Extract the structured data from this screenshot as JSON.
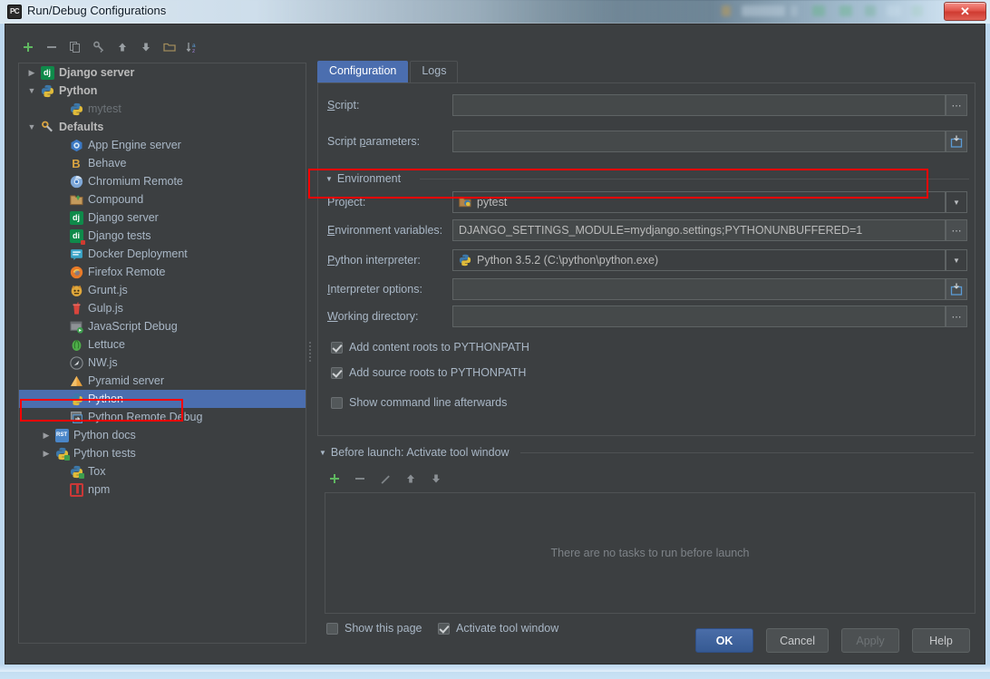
{
  "window": {
    "title": "Run/Debug Configurations",
    "app_icon": "PC",
    "close_label": "✕"
  },
  "tree_toolbar": [
    {
      "name": "add-configuration-button",
      "glyph": "+",
      "color": "#5fb760"
    },
    {
      "name": "remove-configuration-button",
      "glyph": "−",
      "color": "#8a8f93"
    },
    {
      "name": "copy-configuration-button",
      "glyph": "❐",
      "color": "#8a8f93"
    },
    {
      "name": "edit-templates-button",
      "glyph": "⚙",
      "color": "#8a8f93"
    },
    {
      "name": "move-up-button",
      "glyph": "↑",
      "color": "#9aa0a4"
    },
    {
      "name": "move-down-button",
      "glyph": "↓",
      "color": "#9aa0a4"
    },
    {
      "name": "create-folder-button",
      "glyph": "▱",
      "color": "#a08b5b"
    },
    {
      "name": "sort-alphabetically-button",
      "glyph": "↓az",
      "color": "#9aa0a4"
    }
  ],
  "tree": {
    "items": [
      {
        "label": "Django server",
        "icon": "django-icon",
        "indent": 1,
        "twisty": "collapsed",
        "style": "bold"
      },
      {
        "label": "Python",
        "icon": "python-icon",
        "indent": 1,
        "twisty": "expanded",
        "style": "bold"
      },
      {
        "label": "mytest",
        "icon": "python-icon",
        "indent": 3,
        "twisty": "none",
        "style": "dim"
      },
      {
        "label": "Defaults",
        "icon": "defaults-icon",
        "indent": 1,
        "twisty": "expanded",
        "style": "bold"
      },
      {
        "label": "App Engine server",
        "icon": "app-engine-icon",
        "indent": 3,
        "twisty": "none",
        "style": "normal"
      },
      {
        "label": "Behave",
        "icon": "behave-icon",
        "indent": 3,
        "twisty": "none",
        "style": "normal"
      },
      {
        "label": "Chromium Remote",
        "icon": "chromium-icon",
        "indent": 3,
        "twisty": "none",
        "style": "normal"
      },
      {
        "label": "Compound",
        "icon": "compound-icon",
        "indent": 3,
        "twisty": "none",
        "style": "normal"
      },
      {
        "label": "Django server",
        "icon": "django-icon",
        "indent": 3,
        "twisty": "none",
        "style": "normal"
      },
      {
        "label": "Django tests",
        "icon": "django-tests-icon",
        "indent": 3,
        "twisty": "none",
        "style": "normal"
      },
      {
        "label": "Docker Deployment",
        "icon": "docker-icon",
        "indent": 3,
        "twisty": "none",
        "style": "normal"
      },
      {
        "label": "Firefox Remote",
        "icon": "firefox-icon",
        "indent": 3,
        "twisty": "none",
        "style": "normal"
      },
      {
        "label": "Grunt.js",
        "icon": "grunt-icon",
        "indent": 3,
        "twisty": "none",
        "style": "normal"
      },
      {
        "label": "Gulp.js",
        "icon": "gulp-icon",
        "indent": 3,
        "twisty": "none",
        "style": "normal"
      },
      {
        "label": "JavaScript Debug",
        "icon": "javascript-debug-icon",
        "indent": 3,
        "twisty": "none",
        "style": "normal"
      },
      {
        "label": "Lettuce",
        "icon": "lettuce-icon",
        "indent": 3,
        "twisty": "none",
        "style": "normal"
      },
      {
        "label": "NW.js",
        "icon": "nwjs-icon",
        "indent": 3,
        "twisty": "none",
        "style": "normal"
      },
      {
        "label": "Pyramid server",
        "icon": "pyramid-icon",
        "indent": 3,
        "twisty": "none",
        "style": "normal"
      },
      {
        "label": "Python",
        "icon": "python-icon",
        "indent": 3,
        "twisty": "none",
        "style": "selected"
      },
      {
        "label": "Python Remote Debug",
        "icon": "python-remote-icon",
        "indent": 3,
        "twisty": "none",
        "style": "normal"
      },
      {
        "label": "Python docs",
        "icon": "python-docs-icon",
        "indent": 2,
        "twisty": "collapsed",
        "style": "normal"
      },
      {
        "label": "Python tests",
        "icon": "python-tests-icon",
        "indent": 2,
        "twisty": "collapsed",
        "style": "normal"
      },
      {
        "label": "Tox",
        "icon": "tox-icon",
        "indent": 3,
        "twisty": "none",
        "style": "normal"
      },
      {
        "label": "npm",
        "icon": "npm-icon",
        "indent": 3,
        "twisty": "none",
        "style": "normal"
      }
    ]
  },
  "tabs": [
    {
      "label": "Configuration",
      "active": true
    },
    {
      "label": "Logs",
      "active": false
    }
  ],
  "form": {
    "script": {
      "label": "Script:",
      "mnemonic": "S",
      "value": "",
      "browse": "..."
    },
    "script_parameters": {
      "label": "Script parameters:",
      "mnemonic": "p",
      "value": "",
      "browse": "expand-icon"
    },
    "environment_section": {
      "label": "Environment",
      "expanded": true
    },
    "project": {
      "label": "Project:",
      "value": "pytest",
      "icon": "project-folder-icon"
    },
    "environment_variables": {
      "label": "Environment variables:",
      "mnemonic": "E",
      "value": "DJANGO_SETTINGS_MODULE=mydjango.settings;PYTHONUNBUFFERED=1",
      "browse": "..."
    },
    "python_interpreter": {
      "label": "Python interpreter:",
      "mnemonic": "P",
      "value": "Python 3.5.2 (C:\\python\\python.exe)",
      "icon": "python-icon"
    },
    "interpreter_options": {
      "label": "Interpreter options:",
      "mnemonic": "I",
      "value": "",
      "browse": "expand-icon"
    },
    "working_directory": {
      "label": "Working directory:",
      "mnemonic": "W",
      "value": "",
      "browse": "..."
    },
    "checkboxes": [
      {
        "label": "Add content roots to PYTHONPATH",
        "checked": true,
        "name": "add-content-roots-checkbox"
      },
      {
        "label": "Add source roots to PYTHONPATH",
        "checked": true,
        "name": "add-source-roots-checkbox"
      },
      {
        "label": "Show command line afterwards",
        "checked": false,
        "name": "show-command-line-checkbox"
      }
    ]
  },
  "before_launch": {
    "header": "Before launch: Activate tool window",
    "mnemonic": "B",
    "empty_message": "There are no tasks to run before launch",
    "toolbar": [
      {
        "name": "add-task-button",
        "glyph": "+",
        "color": "#5fb760"
      },
      {
        "name": "remove-task-button",
        "glyph": "−",
        "color": "#7f8488"
      },
      {
        "name": "edit-task-button",
        "glyph": "✎",
        "color": "#7f8488"
      },
      {
        "name": "move-task-up-button",
        "glyph": "↑",
        "color": "#8b9095"
      },
      {
        "name": "move-task-down-button",
        "glyph": "↓",
        "color": "#8b9095"
      }
    ],
    "options": [
      {
        "label": "Show this page",
        "checked": false,
        "name": "show-this-page-checkbox"
      },
      {
        "label": "Activate tool window",
        "checked": true,
        "name": "activate-tool-window-checkbox"
      }
    ]
  },
  "buttons": [
    {
      "label": "OK",
      "style": "primary",
      "name": "ok-button"
    },
    {
      "label": "Cancel",
      "style": "normal",
      "name": "cancel-button"
    },
    {
      "label": "Apply",
      "style": "disabled",
      "name": "apply-button"
    },
    {
      "label": "Help",
      "style": "normal",
      "name": "help-button"
    }
  ],
  "colors": {
    "accent_blue": "#4b6eaf",
    "panel_bg": "#3c3f41",
    "input_bg": "#45494a",
    "text": "#a9b7c6",
    "annotation_red": "#ff0000",
    "frame_blue": "#bcd7ee"
  }
}
